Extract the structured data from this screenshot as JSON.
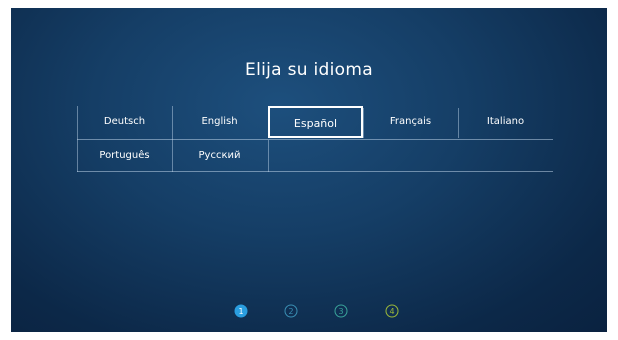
{
  "title": "Elija su idioma",
  "languages": [
    {
      "label": "Deutsch",
      "selected": false
    },
    {
      "label": "English",
      "selected": false
    },
    {
      "label": "Español",
      "selected": true
    },
    {
      "label": "Français",
      "selected": false
    },
    {
      "label": "Italiano",
      "selected": false
    },
    {
      "label": "Português",
      "selected": false
    },
    {
      "label": "Русский",
      "selected": false
    }
  ],
  "steps": {
    "labels": [
      "1",
      "2",
      "3",
      "4"
    ],
    "current": 1,
    "colors": {
      "active_fill": "#2a9ee0",
      "step2": "#3a8fb3",
      "step3": "#39a39a",
      "step4": "#9ab83a"
    }
  }
}
